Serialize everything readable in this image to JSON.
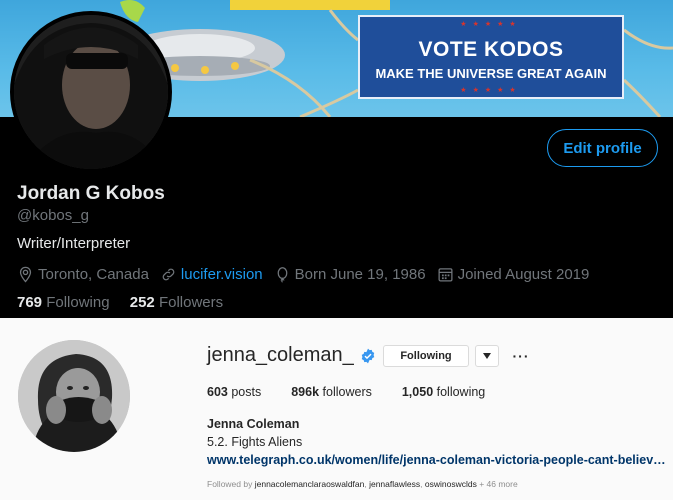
{
  "twitter": {
    "banner": {
      "sign_line1": "VOTE KODOS",
      "sign_line2": "MAKE THE UNIVERSE GREAT AGAIN",
      "stars": "★★★★★"
    },
    "edit_profile_label": "Edit profile",
    "name": "Jordan G Kobos",
    "handle": "@kobos_g",
    "bio": "Writer/Interpreter",
    "location": "Toronto, Canada",
    "website": "lucifer.vision",
    "birthday": "Born June 19, 1986",
    "joined": "Joined August 2019",
    "following_count": "769",
    "following_label": "Following",
    "followers_count": "252",
    "followers_label": "Followers",
    "colors": {
      "accent": "#1d9bf0",
      "background": "#000000",
      "muted": "#71767b"
    }
  },
  "instagram": {
    "username": "jenna_coleman_",
    "following_button": "Following",
    "more_dots": "···",
    "posts_count": "603",
    "posts_label": "posts",
    "followers_count": "896k",
    "followers_label": "followers",
    "following_count": "1,050",
    "following_label": "following",
    "full_name": "Jenna Coleman",
    "bio": "5.2. Fights Aliens",
    "link": "www.telegraph.co.uk/women/life/jenna-coleman-victoria-people-cant-believe...",
    "followed_by_prefix": "Followed by",
    "followed_by_user1": "jennacolemanclaraoswaldfan",
    "followed_by_user2": "jennaflawless",
    "followed_by_user3": "oswinoswclds",
    "followed_by_more": "+ 46 more",
    "colors": {
      "verified": "#3897f0",
      "link": "#003569"
    }
  }
}
